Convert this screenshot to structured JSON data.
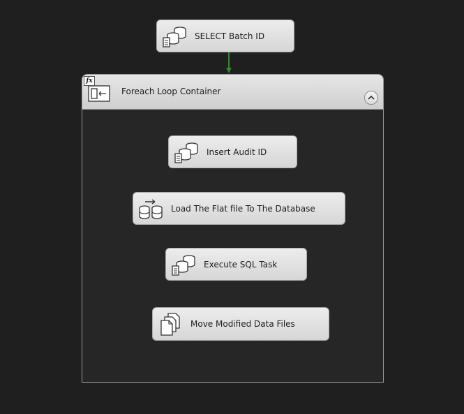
{
  "canvas": {
    "background": "#1f1f1f",
    "precedence_color": "#2e8b2e"
  },
  "tasks": {
    "select_batch_id": {
      "label": "SELECT Batch ID",
      "icon": "execute-sql-icon"
    },
    "insert_audit_id": {
      "label": "Insert Audit ID",
      "icon": "execute-sql-icon"
    },
    "load_flat_file": {
      "label": "Load The Flat file To The Database",
      "icon": "data-flow-icon"
    },
    "execute_sql_task": {
      "label": "Execute SQL Task",
      "icon": "execute-sql-icon"
    },
    "move_modified_files": {
      "label": "Move Modified Data Files",
      "icon": "file-system-icon"
    }
  },
  "container": {
    "title": "Foreach Loop Container",
    "badge": "fx",
    "icon": "foreach-loop-icon",
    "collapse_icon": "chevron-up-icon"
  }
}
